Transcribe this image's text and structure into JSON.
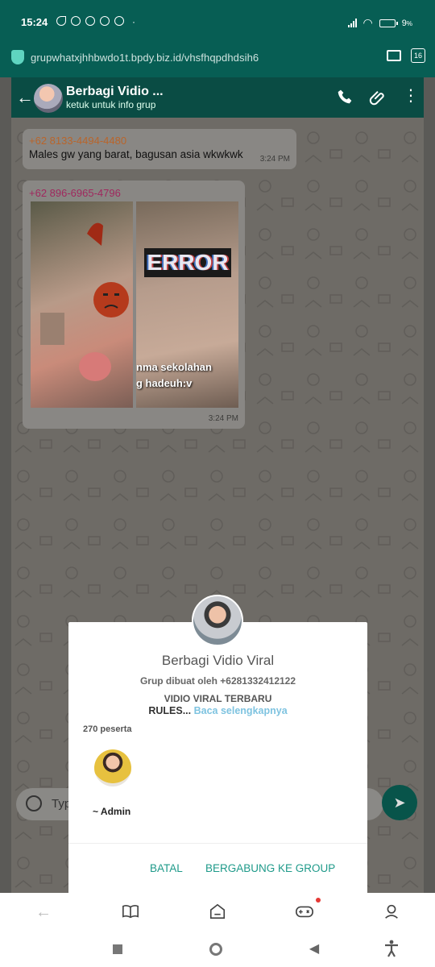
{
  "status_bar": {
    "time": "15:24",
    "battery_text": "9",
    "battery_unit": "%"
  },
  "browser": {
    "url": "grupwhatxjhhbwdo1t.bpdy.biz.id/vhsfhqpdhdsih6",
    "tab_count": "16"
  },
  "chat_header": {
    "group_name": "Berbagi Vidio ...",
    "subtitle": "ketuk untuk info grup"
  },
  "messages": [
    {
      "sender": "+62 8133-4494-4480",
      "sender_color": "#b9652b",
      "text": "Males gw yang barat, bagusan asia wkwkwk",
      "time": "3:24 PM"
    },
    {
      "sender": "+62 896-6965-4796",
      "sender_color": "#a0285e",
      "image_text_error": "ERROR",
      "image_caption_line1": "nma sekolahan",
      "image_caption_line2": "g hadeuh:v",
      "time": "3:24 PM"
    }
  ],
  "input": {
    "placeholder": "Typ"
  },
  "dialog": {
    "group_title": "Berbagi Vidio Viral",
    "created_by": "Grup dibuat oleh +6281332412122",
    "description": "VIDIO VIRAL TERBARU",
    "rules": "RULES...",
    "read_more": "Baca selengkapnya",
    "participants": "270 peserta",
    "member_label": "~ Admin",
    "cancel_label": "BATAL",
    "join_label": "BERGABUNG KE GROUP",
    "accent_color": "#1f9a8a"
  },
  "browser_nav": {
    "icons": [
      "back-arrow-icon",
      "book-icon",
      "home-icon",
      "gamepad-icon",
      "profile-icon"
    ]
  },
  "system_nav": {
    "icons": [
      "recents-icon",
      "home-circle-icon",
      "back-triangle-icon",
      "accessibility-icon"
    ]
  }
}
